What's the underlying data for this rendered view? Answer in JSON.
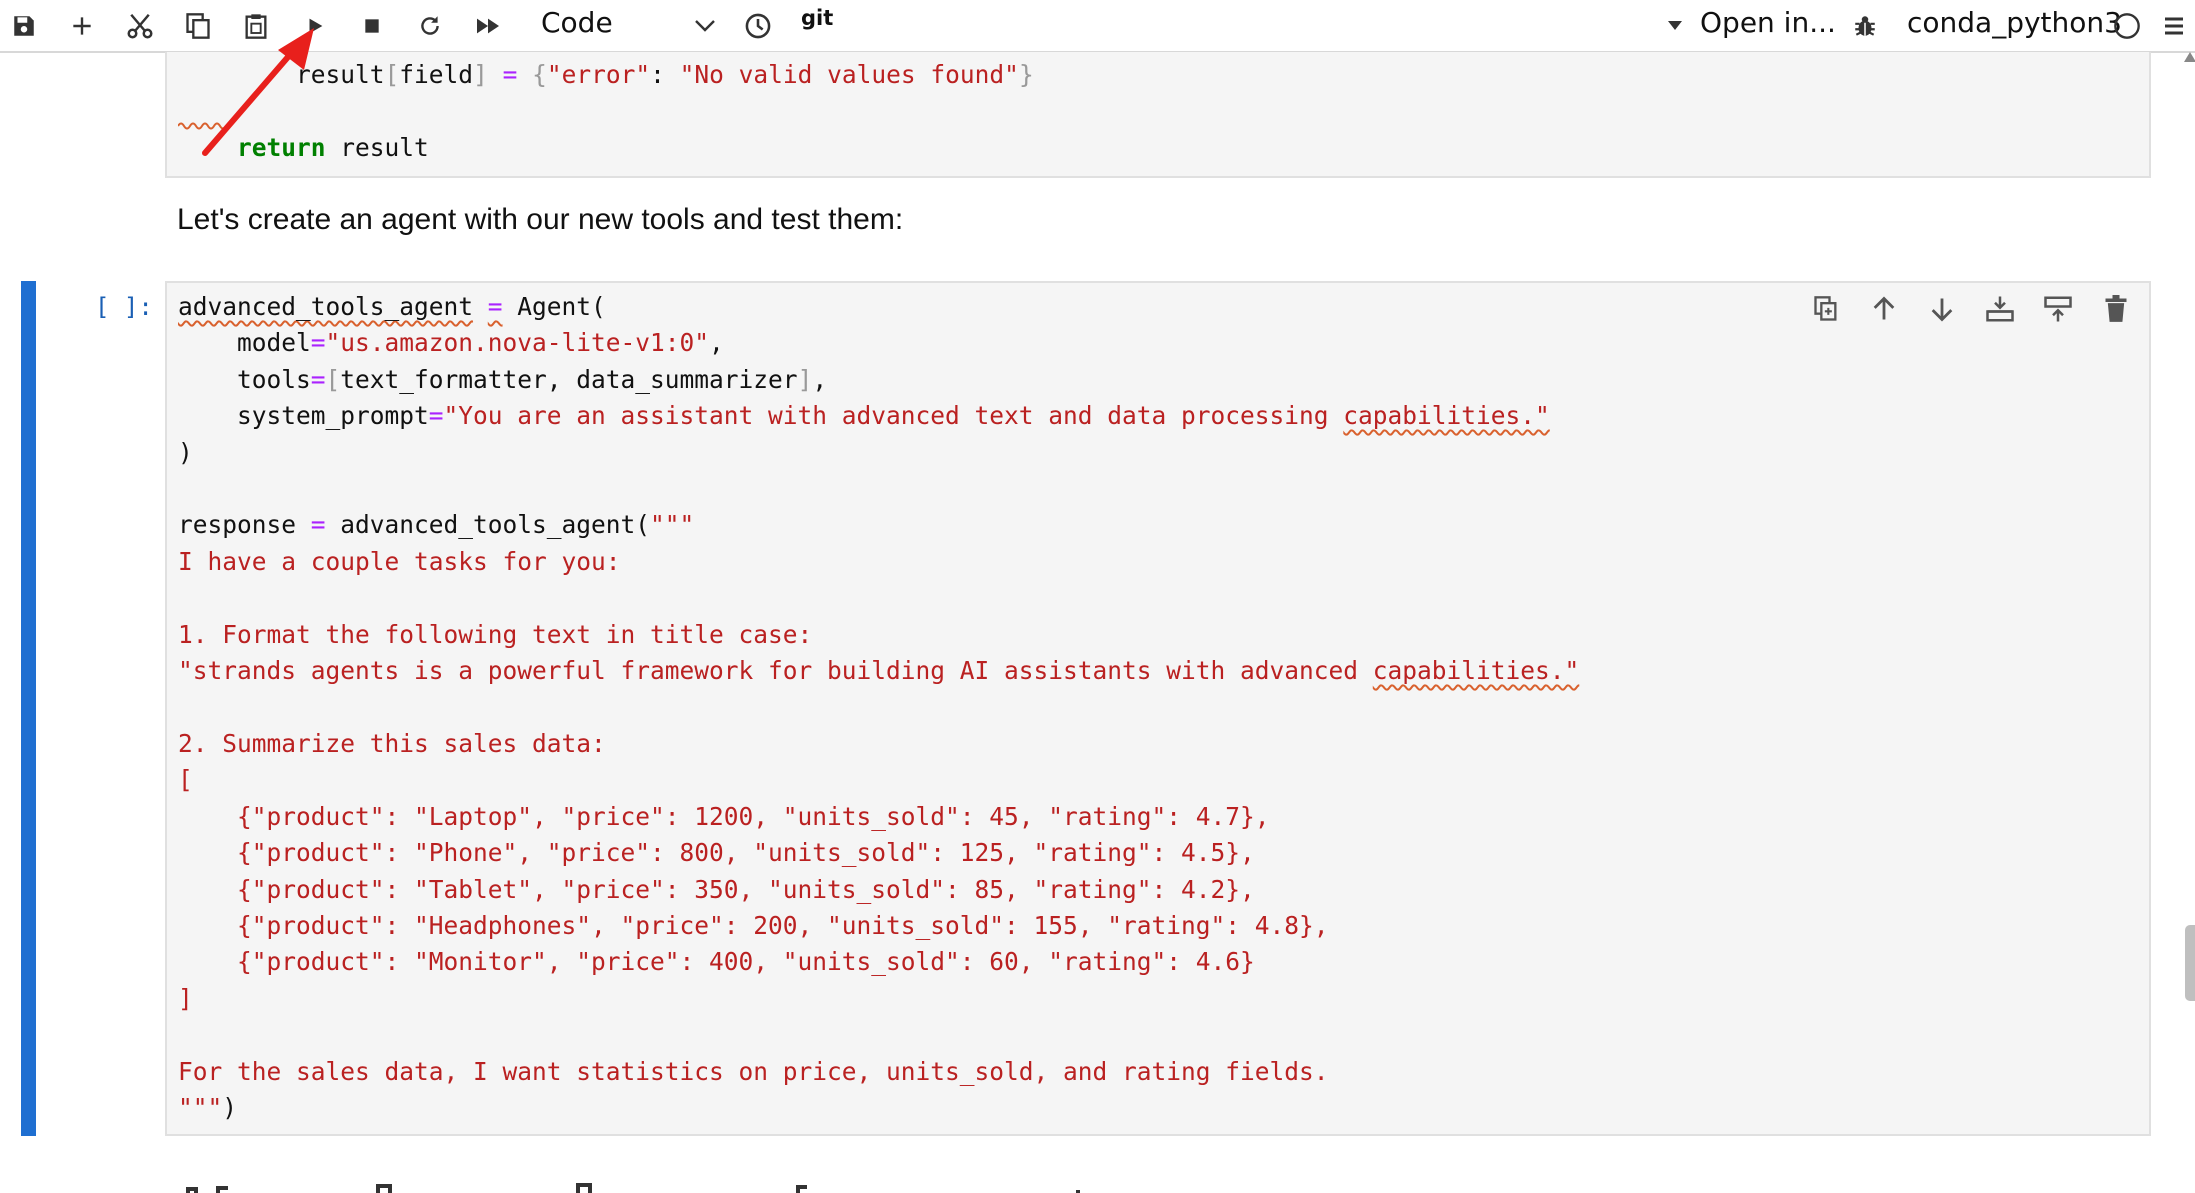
{
  "toolbar": {
    "cell_type": "Code",
    "git_label": "git",
    "open_in_label": "Open in...",
    "kernel_name": "conda_python3"
  },
  "icons": [
    "save-icon",
    "add-cell-icon",
    "cut-icon",
    "copy-icon",
    "paste-icon",
    "run-icon",
    "stop-icon",
    "restart-icon",
    "fast-forward-icon",
    "clock-icon",
    "bug-icon",
    "menu-icon"
  ],
  "annotation": {
    "arrow_color": "#e8201c"
  },
  "previous_cell": {
    "line1": {
      "indent": "        ",
      "a": "result",
      "b": "[",
      "c": "field",
      "d": "]",
      "e": " ",
      "f": "=",
      "g": " ",
      "h": "{",
      "i": "\"error\"",
      "j": ": ",
      "k": "\"No valid values found\"",
      "l": "}"
    },
    "line2": {
      "indent": "    ",
      "kw": "return",
      "rest": " result"
    }
  },
  "markdown": {
    "text": "Let's create an agent with our new tools and test them:"
  },
  "active_cell": {
    "prompt": "[ ]:",
    "accent_color": "#1f6fd1",
    "lines": {
      "l1a": "advanced_tools_agent",
      "l1b": " ",
      "l1c": "=",
      "l1d": " Agent(",
      "l2a": "    model",
      "l2b": "=",
      "l2c": "\"us.amazon.nova-lite-v1:0\"",
      "l2d": ",",
      "l3a": "    tools",
      "l3b": "=",
      "l3c": "[",
      "l3d": "text_formatter, data_summarizer",
      "l3e": "]",
      "l3f": ",",
      "l4a": "    system_prompt",
      "l4b": "=",
      "l4c": "\"You are an assistant with advanced text and data processing ",
      "l4d": "capabilities.\"",
      "l5": ")",
      "l7a": "response ",
      "l7b": "=",
      "l7c": " advanced_tools_agent(",
      "l7d": "\"\"\"",
      "l8": "I have a couple tasks for you:",
      "l10": "1. Format the following text in title case:",
      "l11a": "\"strands agents is a powerful framework for building AI assistants with advanced ",
      "l11b": "capabilities.\"",
      "l13": "2. Summarize this sales data:",
      "l14": "[",
      "l15": "    {\"product\": \"Laptop\", \"price\": 1200, \"units_sold\": 45, \"rating\": 4.7},",
      "l16": "    {\"product\": \"Phone\", \"price\": 800, \"units_sold\": 125, \"rating\": 4.5},",
      "l17": "    {\"product\": \"Tablet\", \"price\": 350, \"units_sold\": 85, \"rating\": 4.2},",
      "l18": "    {\"product\": \"Headphones\", \"price\": 200, \"units_sold\": 155, \"rating\": 4.8},",
      "l19": "    {\"product\": \"Monitor\", \"price\": 400, \"units_sold\": 60, \"rating\": 4.6}",
      "l20": "]",
      "l22": "For the sales data, I want statistics on price, units_sold, and rating fields.",
      "l23a": "\"\"\"",
      "l23b": ")"
    },
    "cell_tools": [
      "duplicate-cell-icon",
      "move-up-icon",
      "move-down-icon",
      "insert-below-icon",
      "insert-above-icon",
      "delete-icon"
    ]
  }
}
